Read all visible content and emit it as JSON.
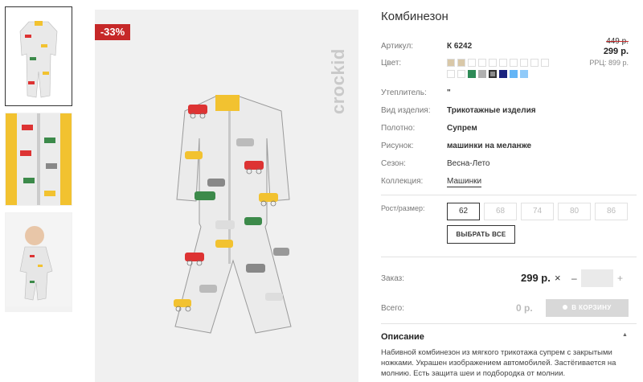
{
  "product": {
    "title": "Комбинезон",
    "discount_badge": "-33%",
    "brand_logo": "crockid",
    "price_old": "449 р.",
    "price_new": "299 р.",
    "price_rrp": "РРЦ: 899 р."
  },
  "specs": [
    {
      "label": "Артикул:",
      "value": "К 6242"
    },
    {
      "label": "Цвет:",
      "value": ""
    },
    {
      "label": "Утеплитель:",
      "value": "\""
    },
    {
      "label": "Вид изделия:",
      "value": "Трикотажные изделия"
    },
    {
      "label": "Полотно:",
      "value": "Супрем"
    },
    {
      "label": "Рисунок:",
      "value": "машинки на меланже"
    },
    {
      "label": "Сезон:",
      "value": "Весна-Лето"
    },
    {
      "label": "Коллекция:",
      "value": "Машинки"
    }
  ],
  "colors": {
    "row1": [
      "#d9c8a8",
      "#d9c8a8",
      "#ffffff",
      "#ffffff",
      "#ffffff",
      "#ffffff",
      "#ffffff",
      "#ffffff",
      "#ffffff",
      "#ffffff"
    ],
    "row2": [
      "#ffffff",
      "#ffffff",
      "#2e8b57",
      "#b0b0b0",
      "#8c8c8c",
      "#1a237e",
      "#64b5f6",
      "#90caf9"
    ],
    "selected_index_row2": 4
  },
  "sizes": {
    "label": "Рост/размер:",
    "options": [
      "62",
      "68",
      "74",
      "80",
      "86"
    ],
    "selected": "62",
    "select_all_label": "ВЫБРАТЬ ВСЕ"
  },
  "order": {
    "label": "Заказ:",
    "price": "299 р.",
    "remove_glyph": "×",
    "minus_glyph": "–",
    "plus_glyph": "+",
    "quantity": ""
  },
  "total": {
    "label": "Всего:",
    "value": "0 р.",
    "cart_button": "В КОРЗИНУ"
  },
  "description": {
    "title": "Описание",
    "caret": "▲",
    "text": "Набивной комбинезон из мягкого трикотажа супрем с закрытыми ножками. Украшен изображением автомобилей. Застёгивается на молнию. Есть защита шеи и подбородка от молнии."
  }
}
